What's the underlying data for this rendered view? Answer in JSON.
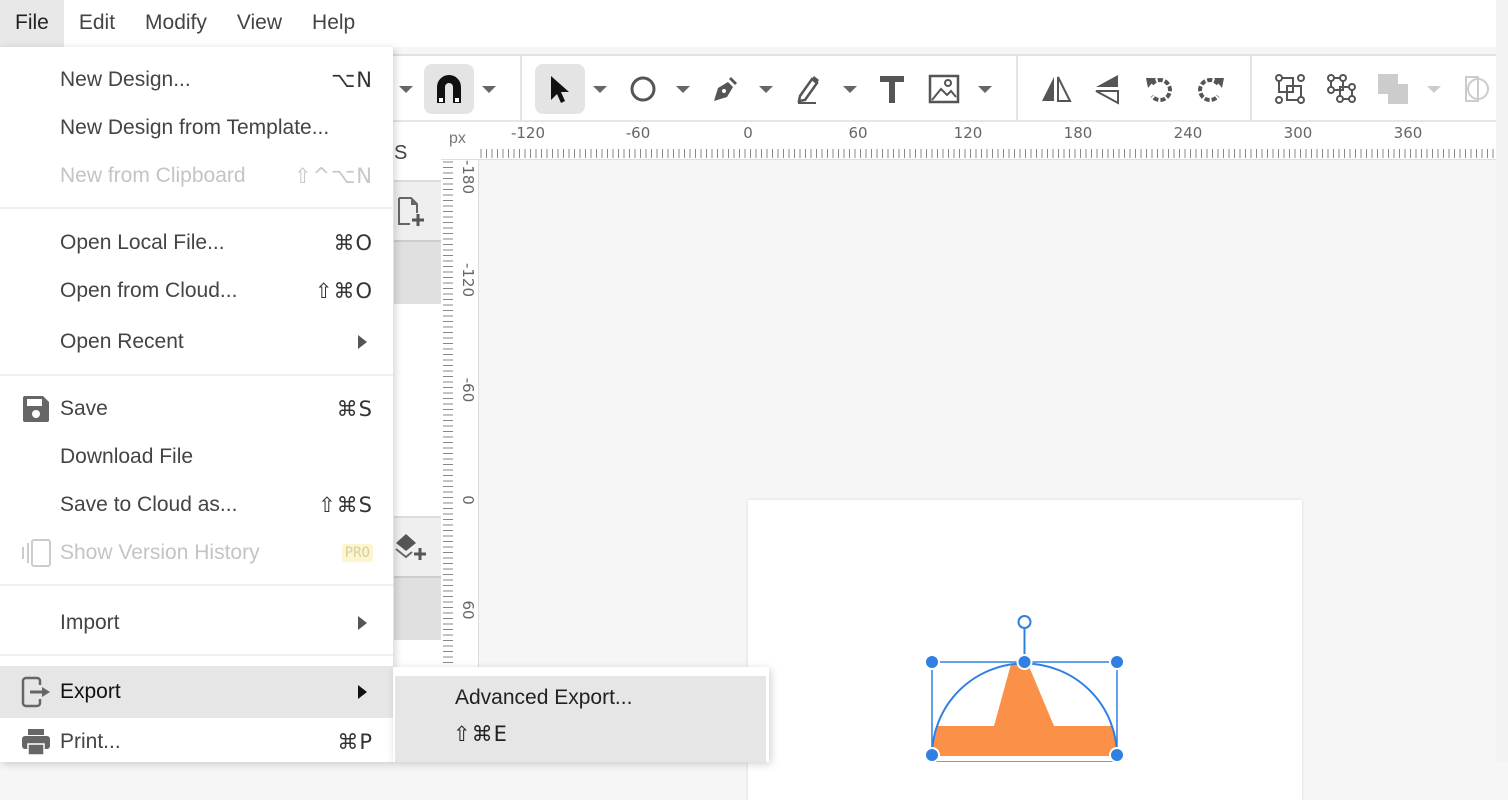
{
  "menubar": {
    "items": [
      {
        "label": "File",
        "active": true
      },
      {
        "label": "Edit"
      },
      {
        "label": "Modify"
      },
      {
        "label": "View"
      },
      {
        "label": "Help"
      }
    ]
  },
  "file_menu": {
    "items": [
      {
        "label": "New Design...",
        "shortcut": "⌥N"
      },
      {
        "label": "New Design from Template..."
      },
      {
        "label": "New from Clipboard",
        "shortcut": "⇧^⌥N",
        "disabled": true
      },
      {
        "label": "Open Local File...",
        "shortcut": "⌘O"
      },
      {
        "label": "Open from Cloud...",
        "shortcut": "⇧⌘O"
      },
      {
        "label": "Open Recent",
        "submenu": true
      },
      {
        "label": "Save",
        "shortcut": "⌘S",
        "icon": "save-icon"
      },
      {
        "label": "Download File"
      },
      {
        "label": "Save to Cloud as...",
        "shortcut": "⇧⌘S"
      },
      {
        "label": "Show Version History",
        "badge": "PRO",
        "disabled": true,
        "icon": "version-history-icon"
      },
      {
        "label": "Import",
        "submenu": true
      },
      {
        "label": "Export",
        "submenu": true,
        "highlighted": true,
        "icon": "export-icon"
      },
      {
        "label": "Print...",
        "shortcut": "⌘P",
        "icon": "print-icon"
      }
    ]
  },
  "export_submenu": {
    "items": [
      {
        "label": "Advanced Export...",
        "shortcut": "⇧⌘E"
      }
    ]
  },
  "toolbar": {
    "tools": [
      "snap-magnet",
      "pointer",
      "ellipse",
      "pen",
      "pencil",
      "text",
      "image",
      "flip-horizontal",
      "flip-vertical",
      "rotate-ccw",
      "rotate-cw",
      "group",
      "ungroup",
      "arrange",
      "mask"
    ]
  },
  "side_panel": {
    "tab_label_fragment": "S"
  },
  "rulers": {
    "unit": "px",
    "top_labels": [
      "-120",
      "-60",
      "0",
      "60",
      "120",
      "180",
      "240",
      "300",
      "360"
    ],
    "left_labels": [
      "-180",
      "-120",
      "-60",
      "0",
      "60"
    ]
  },
  "colors": {
    "selection": "#2f80e0",
    "shape_fill": "#fb9149",
    "menu_highlight": "#e6e6e6"
  }
}
